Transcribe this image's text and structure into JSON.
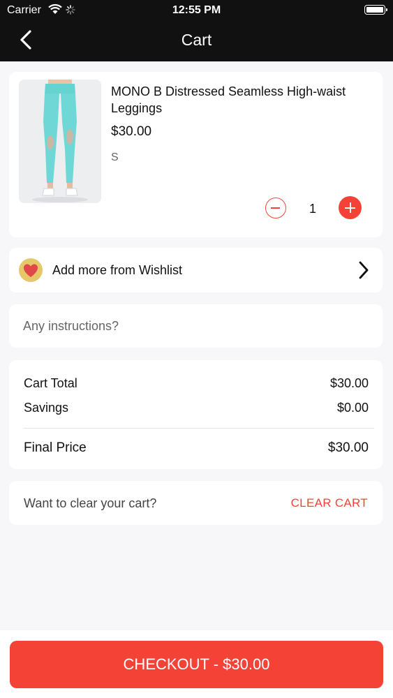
{
  "status_bar": {
    "carrier": "Carrier",
    "time": "12:55 PM"
  },
  "nav": {
    "title": "Cart",
    "back_icon": "chevron-left-icon"
  },
  "cart_item": {
    "name": "MONO B Distressed Seamless High-waist Leggings",
    "price": "$30.00",
    "size": "S",
    "quantity": "1",
    "image_desc_icon": "product-image-turquoise-leggings"
  },
  "wishlist": {
    "label": "Add more from Wishlist",
    "icon": "heart-icon"
  },
  "instructions": {
    "placeholder": "Any instructions?",
    "value": ""
  },
  "totals": {
    "cart_total_label": "Cart Total",
    "cart_total_value": "$30.00",
    "savings_label": "Savings",
    "savings_value": "$0.00",
    "final_label": "Final Price",
    "final_value": "$30.00"
  },
  "clear_cart": {
    "question": "Want to clear your cart?",
    "button_label": "CLEAR CART"
  },
  "checkout": {
    "label": "CHECKOUT - $30.00"
  },
  "colors": {
    "accent": "#f44336",
    "header_bg": "#111111",
    "page_bg": "#f7f6f8",
    "product_teal": "#6fd8d6"
  }
}
